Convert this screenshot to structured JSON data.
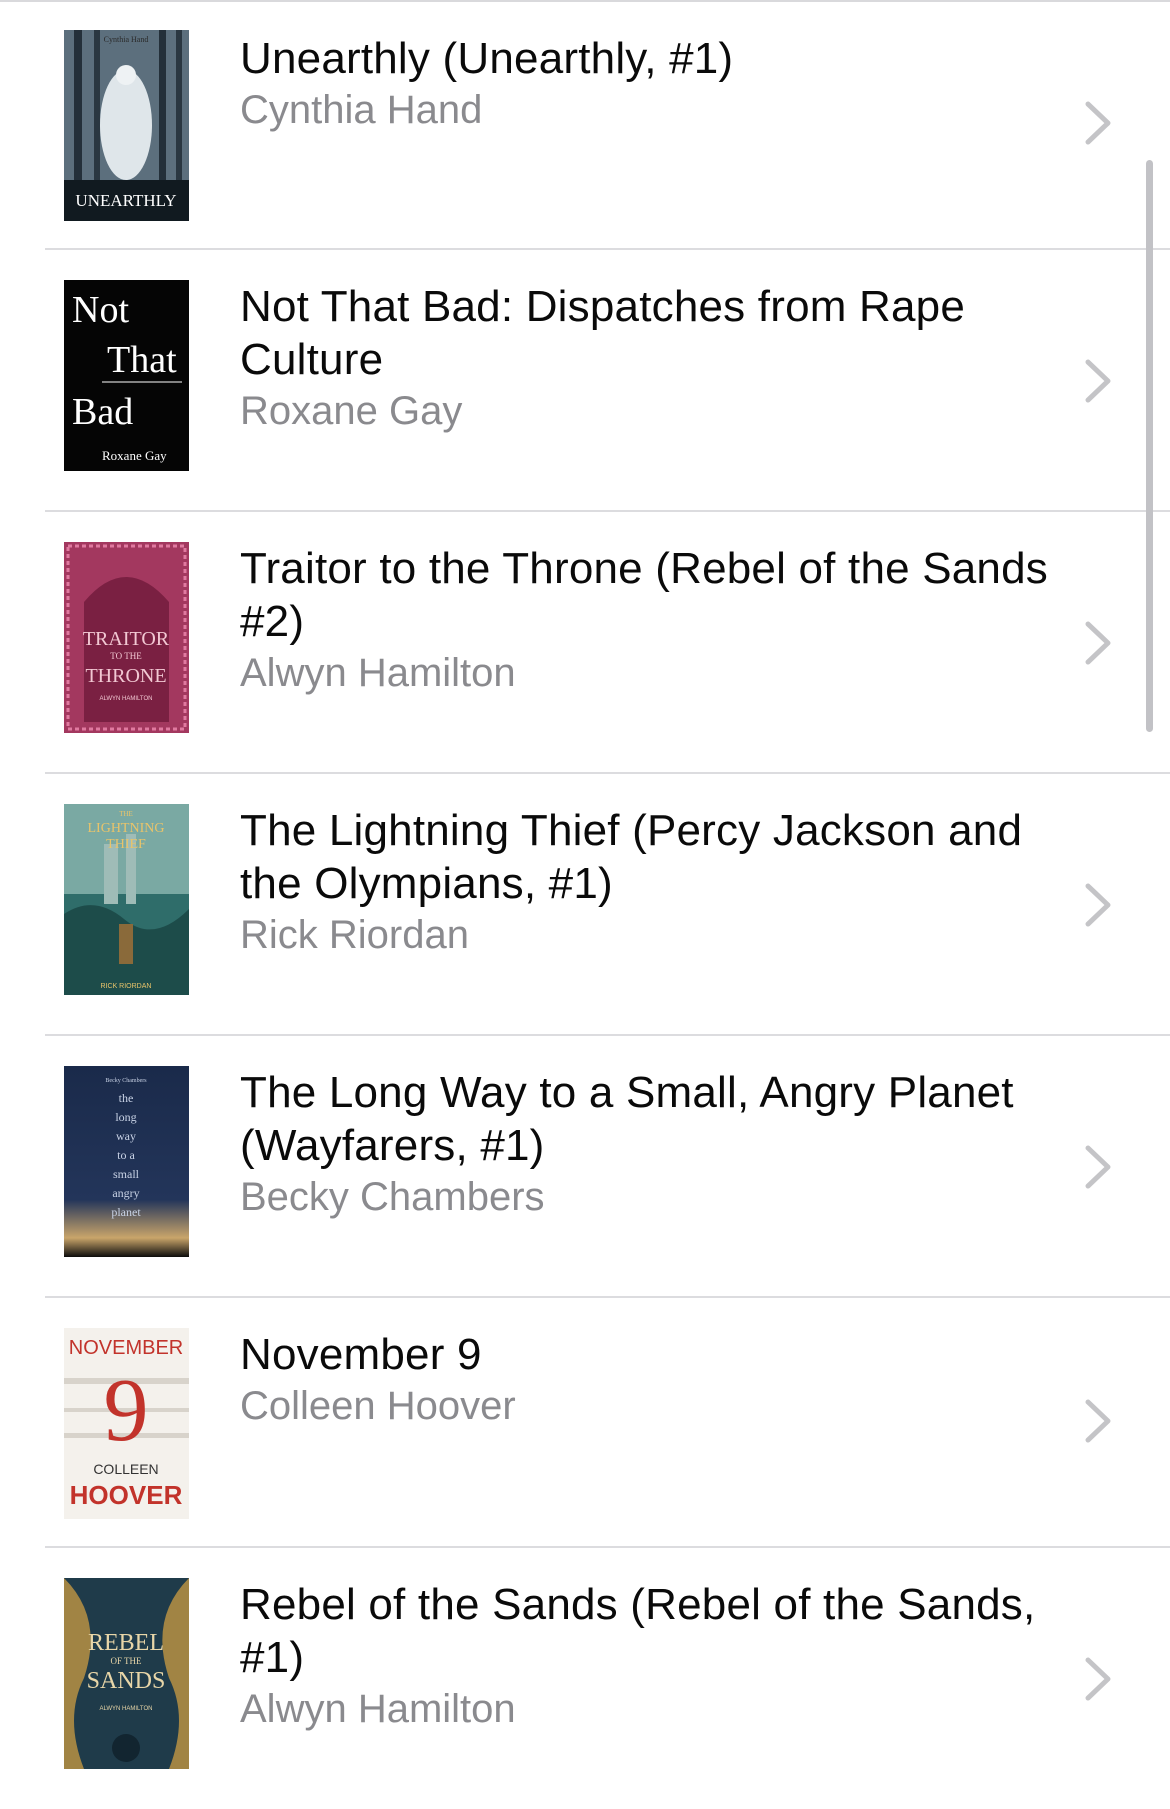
{
  "books": [
    {
      "title": "Unearthly (Unearthly, #1)",
      "author": "Cynthia Hand",
      "cover_text": [
        "Cynthia Hand",
        "UNEARTHLY"
      ],
      "cover_colors": {
        "bg": "#2f3b45",
        "accent": "#e8eef2"
      }
    },
    {
      "title": "Not That Bad: Dispatches from Rape Culture",
      "author": "Roxane Gay",
      "cover_text": [
        "Not",
        "That",
        "Bad",
        "Roxane Gay"
      ],
      "cover_colors": {
        "bg": "#050505",
        "accent": "#ffffff"
      }
    },
    {
      "title": "Traitor to the Throne (Rebel of the Sands #2)",
      "author": "Alwyn Hamilton",
      "cover_text": [
        "TRAITOR",
        "TO THE",
        "THRONE",
        "ALWYN HAMILTON"
      ],
      "cover_colors": {
        "bg": "#a3385f",
        "accent": "#f2c8d3"
      }
    },
    {
      "title": "The Lightning Thief (Percy Jackson and the Olympians, #1)",
      "author": "Rick Riordan",
      "cover_text": [
        "THE",
        "LIGHTNING",
        "THIEF",
        "RICK RIORDAN"
      ],
      "cover_colors": {
        "bg": "#2f6d6a",
        "accent": "#e9c46a"
      }
    },
    {
      "title": "The Long Way to a Small, Angry Planet (Wayfarers, #1)",
      "author": "Becky Chambers",
      "cover_text": [
        "Becky Chambers",
        "the",
        "long",
        "way",
        "to a",
        "small",
        "angry",
        "planet"
      ],
      "cover_colors": {
        "bg": "#1b2740",
        "accent": "#c9d3e6"
      }
    },
    {
      "title": "November 9",
      "author": "Colleen Hoover",
      "cover_text": [
        "NOVEMBER",
        "9",
        "COLLEEN",
        "HOOVER"
      ],
      "cover_colors": {
        "bg": "#f4f1ec",
        "accent": "#c2332b"
      }
    },
    {
      "title": "Rebel of the Sands (Rebel of the Sands, #1)",
      "author": "Alwyn Hamilton",
      "cover_text": [
        "REBEL",
        "OF THE",
        "SANDS",
        "ALWYN HAMILTON"
      ],
      "cover_colors": {
        "bg": "#1f3b4a",
        "accent": "#d9a441"
      }
    }
  ],
  "ui": {
    "chevron_icon": "chevron-right-icon",
    "chevron_color": "#c4c4c7",
    "divider_color": "#dcdcdf",
    "author_color": "#8a8a8e"
  }
}
